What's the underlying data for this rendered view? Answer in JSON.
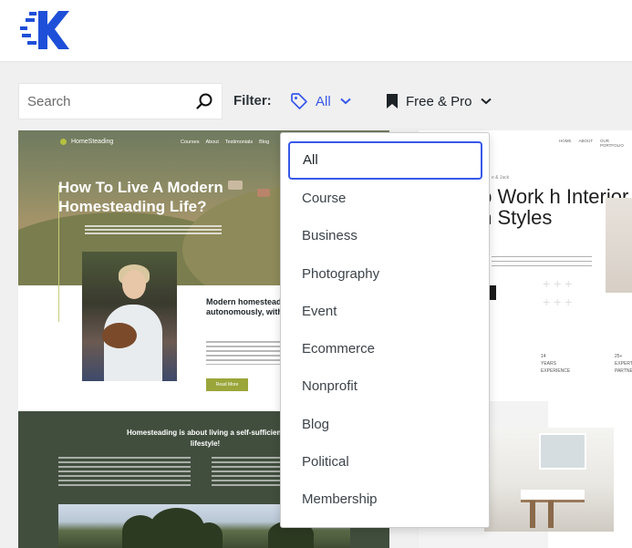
{
  "header": {
    "logo_icon": "brand-logo-icon"
  },
  "search": {
    "placeholder": "Search",
    "icon": "search-icon"
  },
  "filter": {
    "label": "Filter:",
    "category": {
      "value": "All",
      "icon": "tag-icon",
      "color": "#3858e9"
    },
    "price": {
      "value": "Free & Pro",
      "icon": "bookmark-icon"
    }
  },
  "dropdown": {
    "selected": "All",
    "options": [
      "All",
      "Course",
      "Business",
      "Photography",
      "Event",
      "Ecommerce",
      "Nonprofit",
      "Blog",
      "Political",
      "Membership"
    ]
  },
  "cards": [
    {
      "brand": "HomeSteading",
      "nav": [
        "Courses",
        "About",
        "Testimonials",
        "Blog"
      ],
      "title": "How To Live A Modern Homesteading Life?",
      "subtitle": "Modern homesteading sufficient lifestyle – autonomously, with help from others.",
      "button": "Read More",
      "section_title": "Homesteading is about living a self-sufficient lifestyle!"
    },
    {
      "nav": [
        "HOME",
        "ABOUT",
        "OUR PORTFOLIO"
      ],
      "small_text": "e & Jack",
      "title": "w to Work h Interior sign Styles",
      "stats": [
        "14",
        "YEARS",
        "EXPERIENCE",
        "25+",
        "EXPERT",
        "PARTNERS"
      ]
    }
  ]
}
